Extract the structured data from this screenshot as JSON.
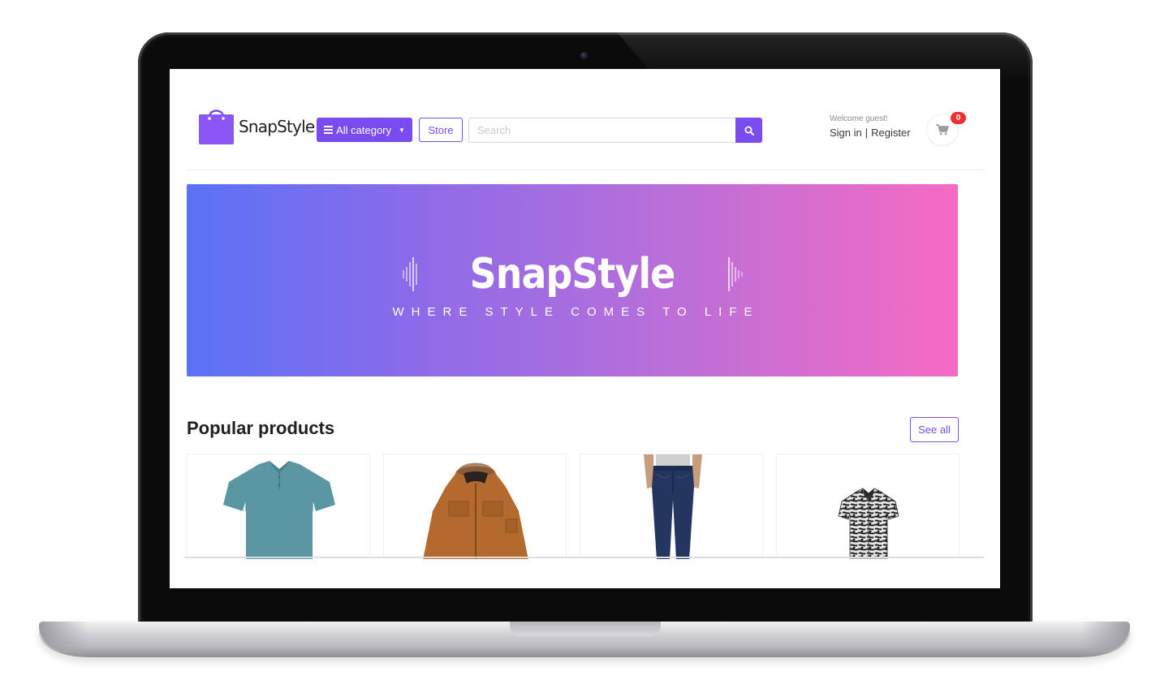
{
  "brand": {
    "name": "SnapStyle",
    "accent": "#7a4cf0"
  },
  "header": {
    "category_button": "All category",
    "store_button": "Store",
    "search": {
      "placeholder": "Search",
      "value": ""
    },
    "welcome": "Welcome guest!",
    "sign_in": "Sign in",
    "separator": "|",
    "register": "Register",
    "cart_count": "0"
  },
  "banner": {
    "title": "SnapStyle",
    "subtitle": "WHERE STYLE COMES TO LIFE"
  },
  "popular": {
    "title": "Popular products",
    "see_all": "See all",
    "products": [
      {
        "icon": "teal-polo-shirt"
      },
      {
        "icon": "brown-parka-jacket"
      },
      {
        "icon": "navy-jeans"
      },
      {
        "icon": "black-white-floral-shirt"
      }
    ]
  }
}
